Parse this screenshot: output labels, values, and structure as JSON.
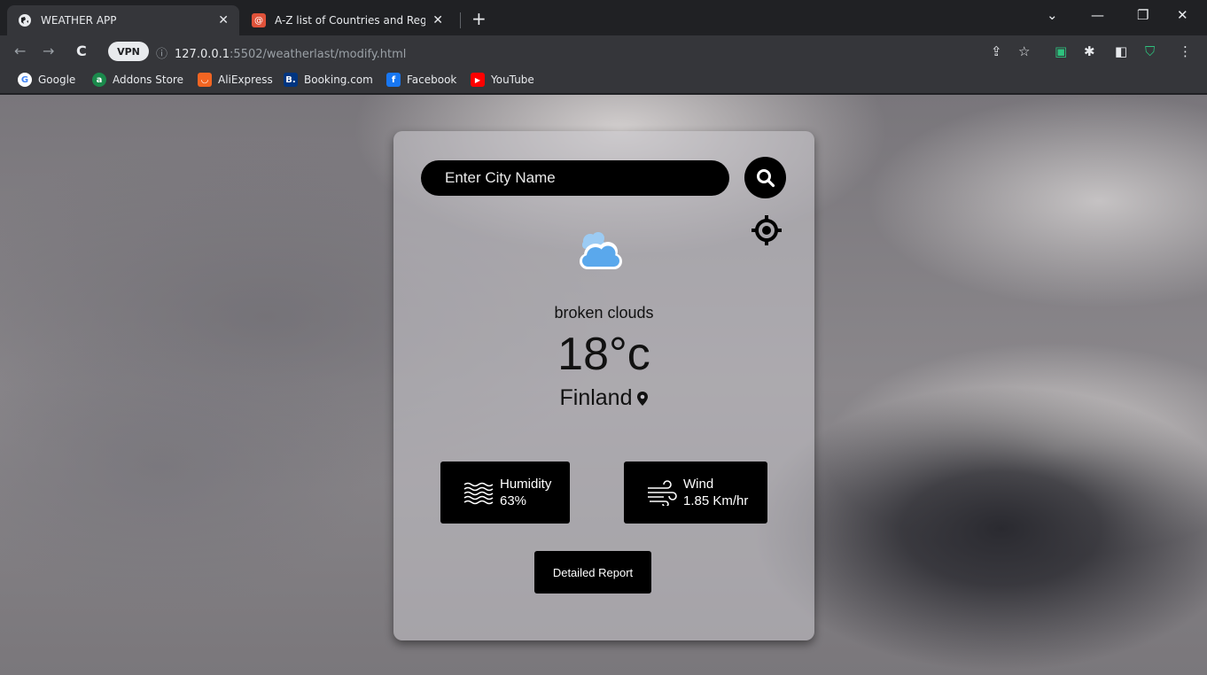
{
  "browser": {
    "tabs": [
      {
        "title": "WEATHER APP",
        "active": true,
        "icon": "globe-icon"
      },
      {
        "title": "A-Z list of Countries and Regions",
        "active": false,
        "icon": "site-favicon-icon"
      }
    ],
    "url": {
      "host": "127.0.0.1",
      "path": ":5502/weatherlast/modify.html"
    },
    "vpn_label": "VPN",
    "bookmarks": [
      {
        "label": "Google",
        "color": "#4285f4",
        "glyph": "G"
      },
      {
        "label": "Addons Store",
        "color": "#1b8a4c",
        "glyph": "a"
      },
      {
        "label": "AliExpress",
        "color": "#f26522",
        "glyph": "◡"
      },
      {
        "label": "Booking.com",
        "color": "#003580",
        "glyph": "B."
      },
      {
        "label": "Facebook",
        "color": "#1877f2",
        "glyph": "f"
      },
      {
        "label": "YouTube",
        "color": "#ff0000",
        "glyph": "▶"
      }
    ]
  },
  "weather": {
    "search": {
      "placeholder": "Enter City Name"
    },
    "icon": "cloud-icon",
    "description": "broken clouds",
    "temperature": "18°c",
    "city": "Finland",
    "humidity": {
      "label": "Humidity",
      "value": "63%"
    },
    "wind": {
      "label": "Wind",
      "value": "1.85 Km/hr"
    },
    "report_button": "Detailed Report"
  },
  "colors": {
    "card_bg": "rgba(200,198,204,0.55)",
    "button_bg": "#000000",
    "cloud": "#6fb4ee"
  }
}
